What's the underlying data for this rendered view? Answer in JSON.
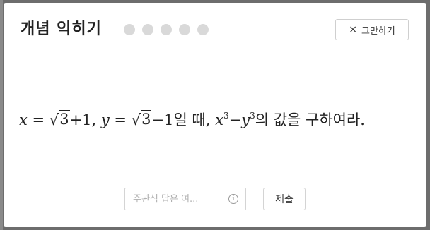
{
  "modal": {
    "title": "개념 익히기",
    "progress": {
      "total": 5,
      "completed": 0
    },
    "quit_button": {
      "icon": "close-icon",
      "label": "그만하기"
    }
  },
  "problem": {
    "x": "x",
    "eq1": " = ",
    "root_symbol": "√",
    "radicand1": "3",
    "plus1": "+1,  ",
    "y": "y",
    "eq2": " = ",
    "radicand2": "3",
    "minus1": "−1",
    "when": "일 때,  ",
    "x2": "x",
    "exp1": "3",
    "minus2": "−",
    "y2": "y",
    "exp2": "3",
    "tail": "의 값을 구하여라."
  },
  "answer": {
    "placeholder": "주관식 답은 여...",
    "value": "",
    "info_icon": "info-icon"
  },
  "submit": {
    "label": "제출"
  },
  "colors": {
    "backdrop": "#6d6d6d",
    "dot_inactive": "#d9d9d9",
    "border": "#d4d4d4"
  }
}
